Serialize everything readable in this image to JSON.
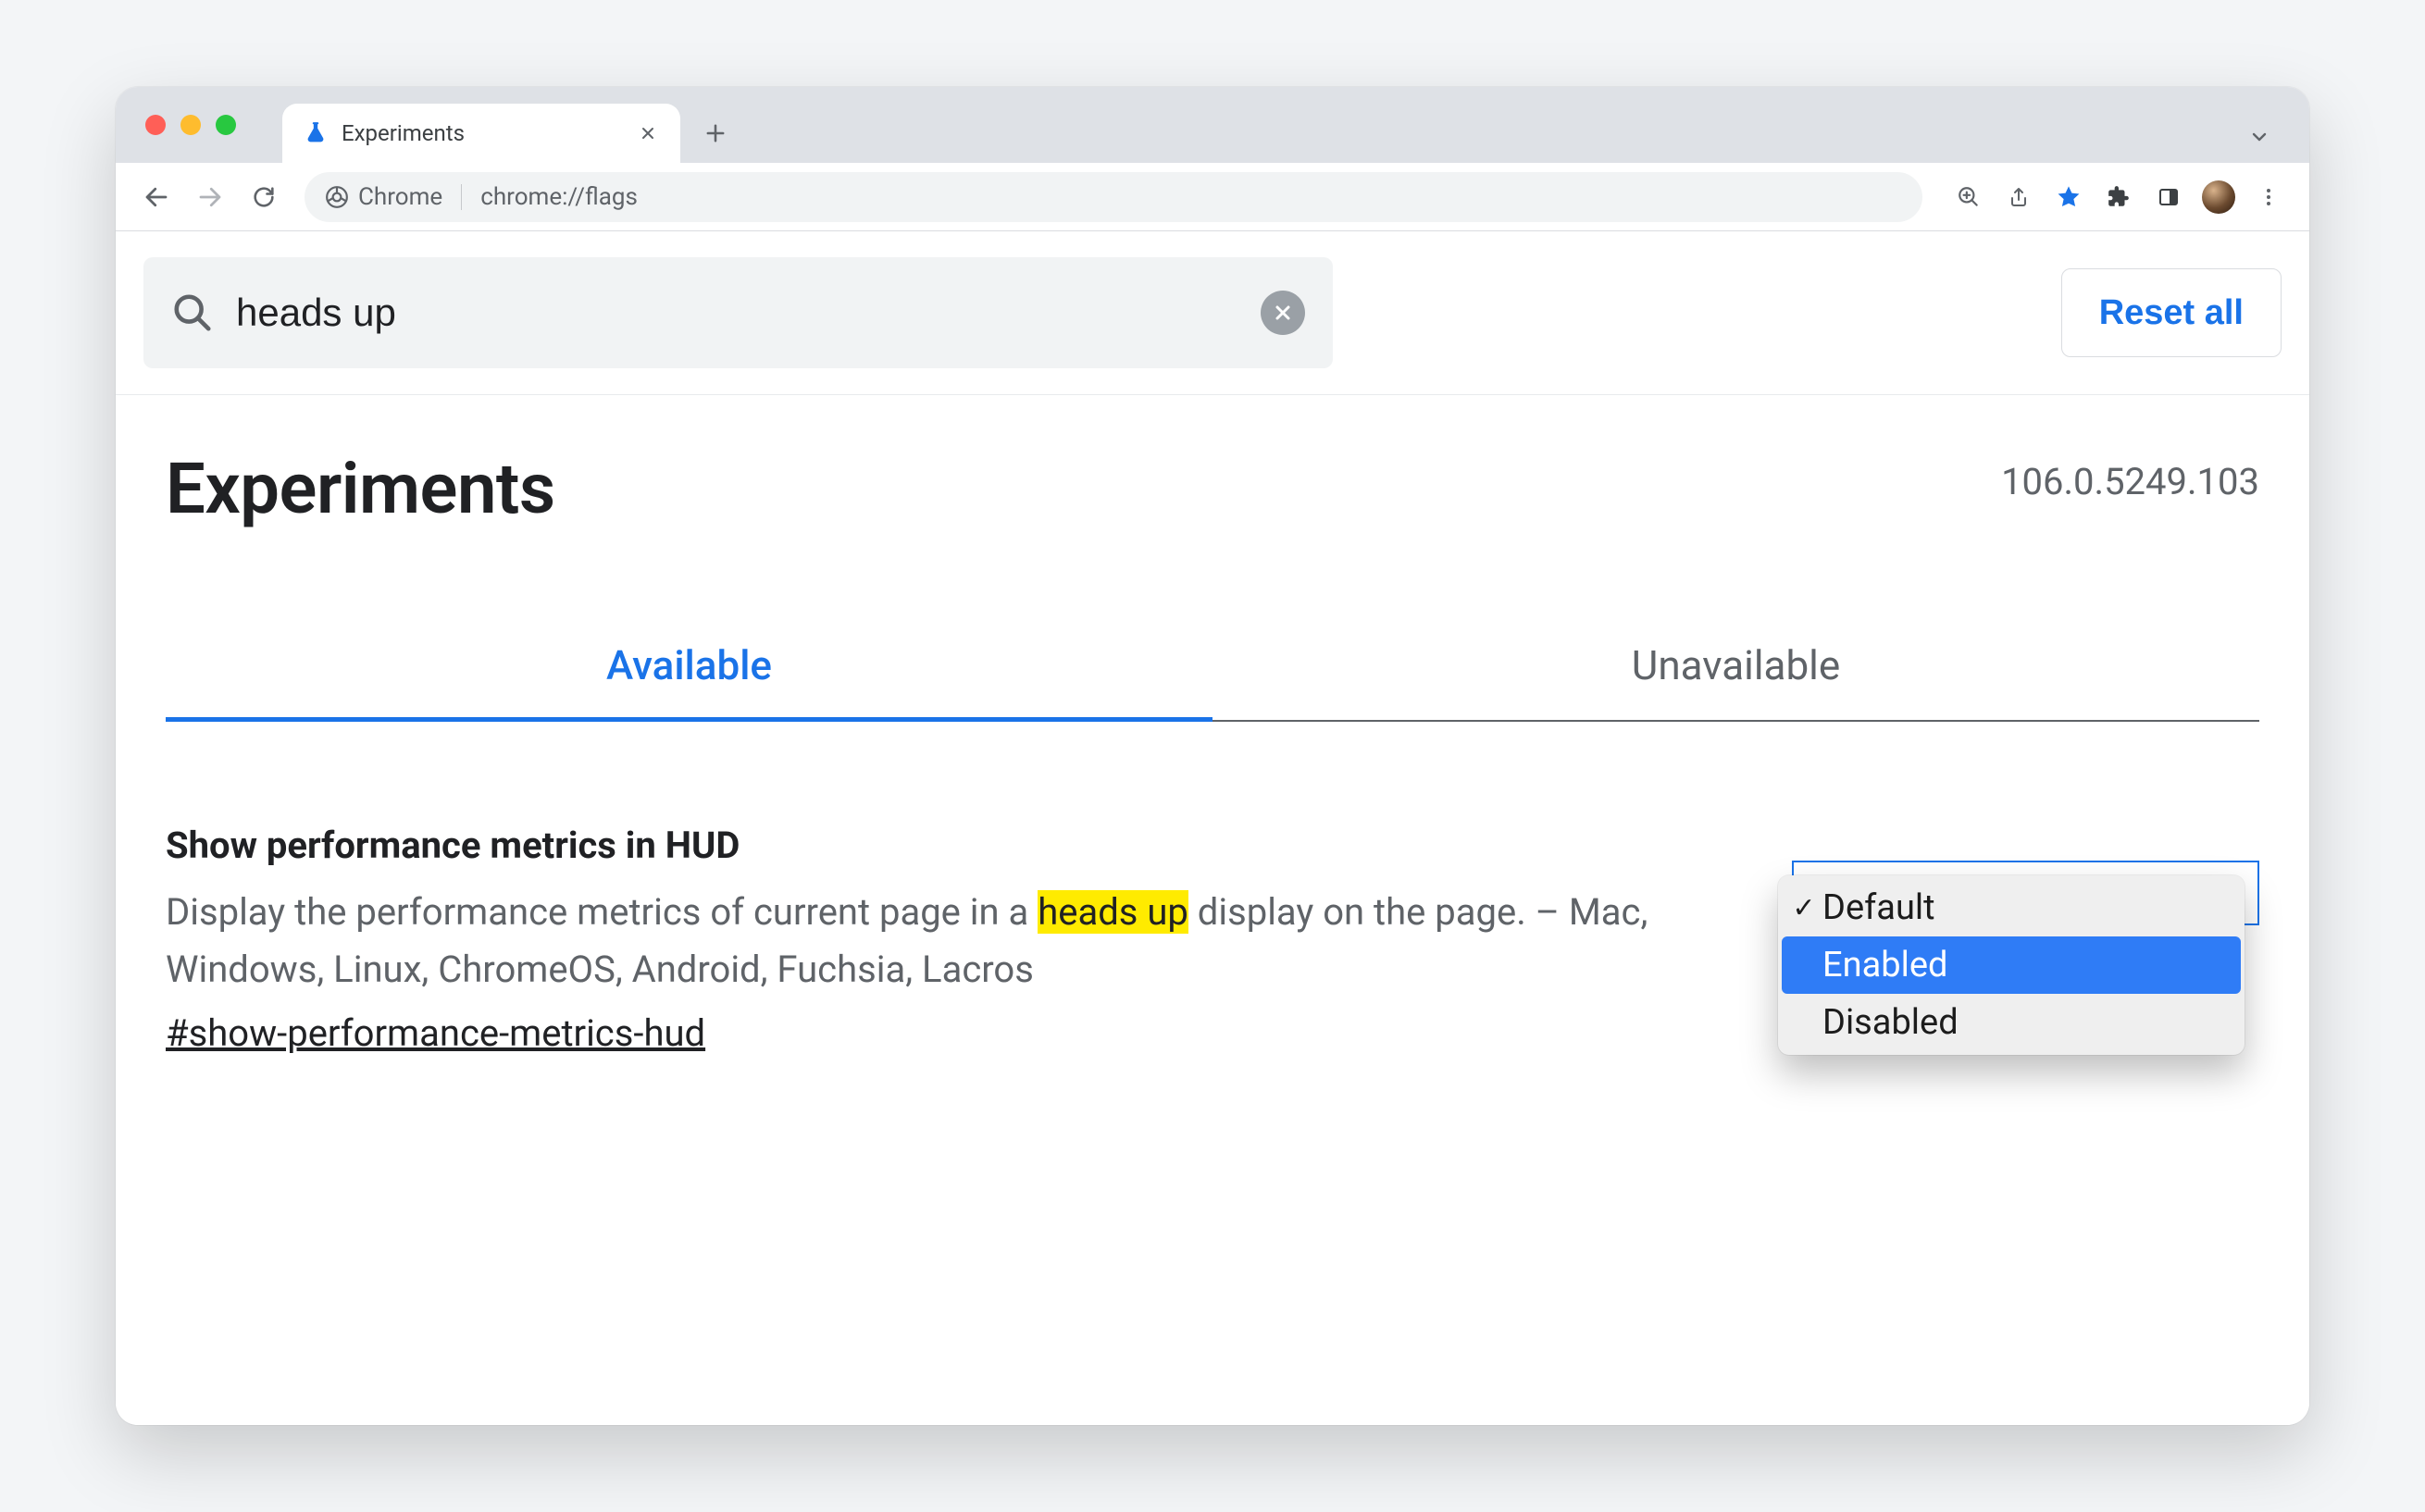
{
  "browser": {
    "tab_title": "Experiments",
    "omnibox_prefix": "Chrome",
    "omnibox_url": "chrome://flags"
  },
  "search": {
    "value": "heads up",
    "reset_label": "Reset all"
  },
  "page": {
    "title": "Experiments",
    "version": "106.0.5249.103"
  },
  "tabs": {
    "available": "Available",
    "unavailable": "Unavailable"
  },
  "flag": {
    "title": "Show performance metrics in HUD",
    "desc_before": "Display the performance metrics of current page in a ",
    "desc_highlight": "heads up",
    "desc_after": " display on the page. – Mac, Windows, Linux, ChromeOS, Android, Fuchsia, Lacros",
    "hash": "#show-performance-metrics-hud",
    "options": {
      "default": "Default",
      "enabled": "Enabled",
      "disabled": "Disabled"
    }
  }
}
